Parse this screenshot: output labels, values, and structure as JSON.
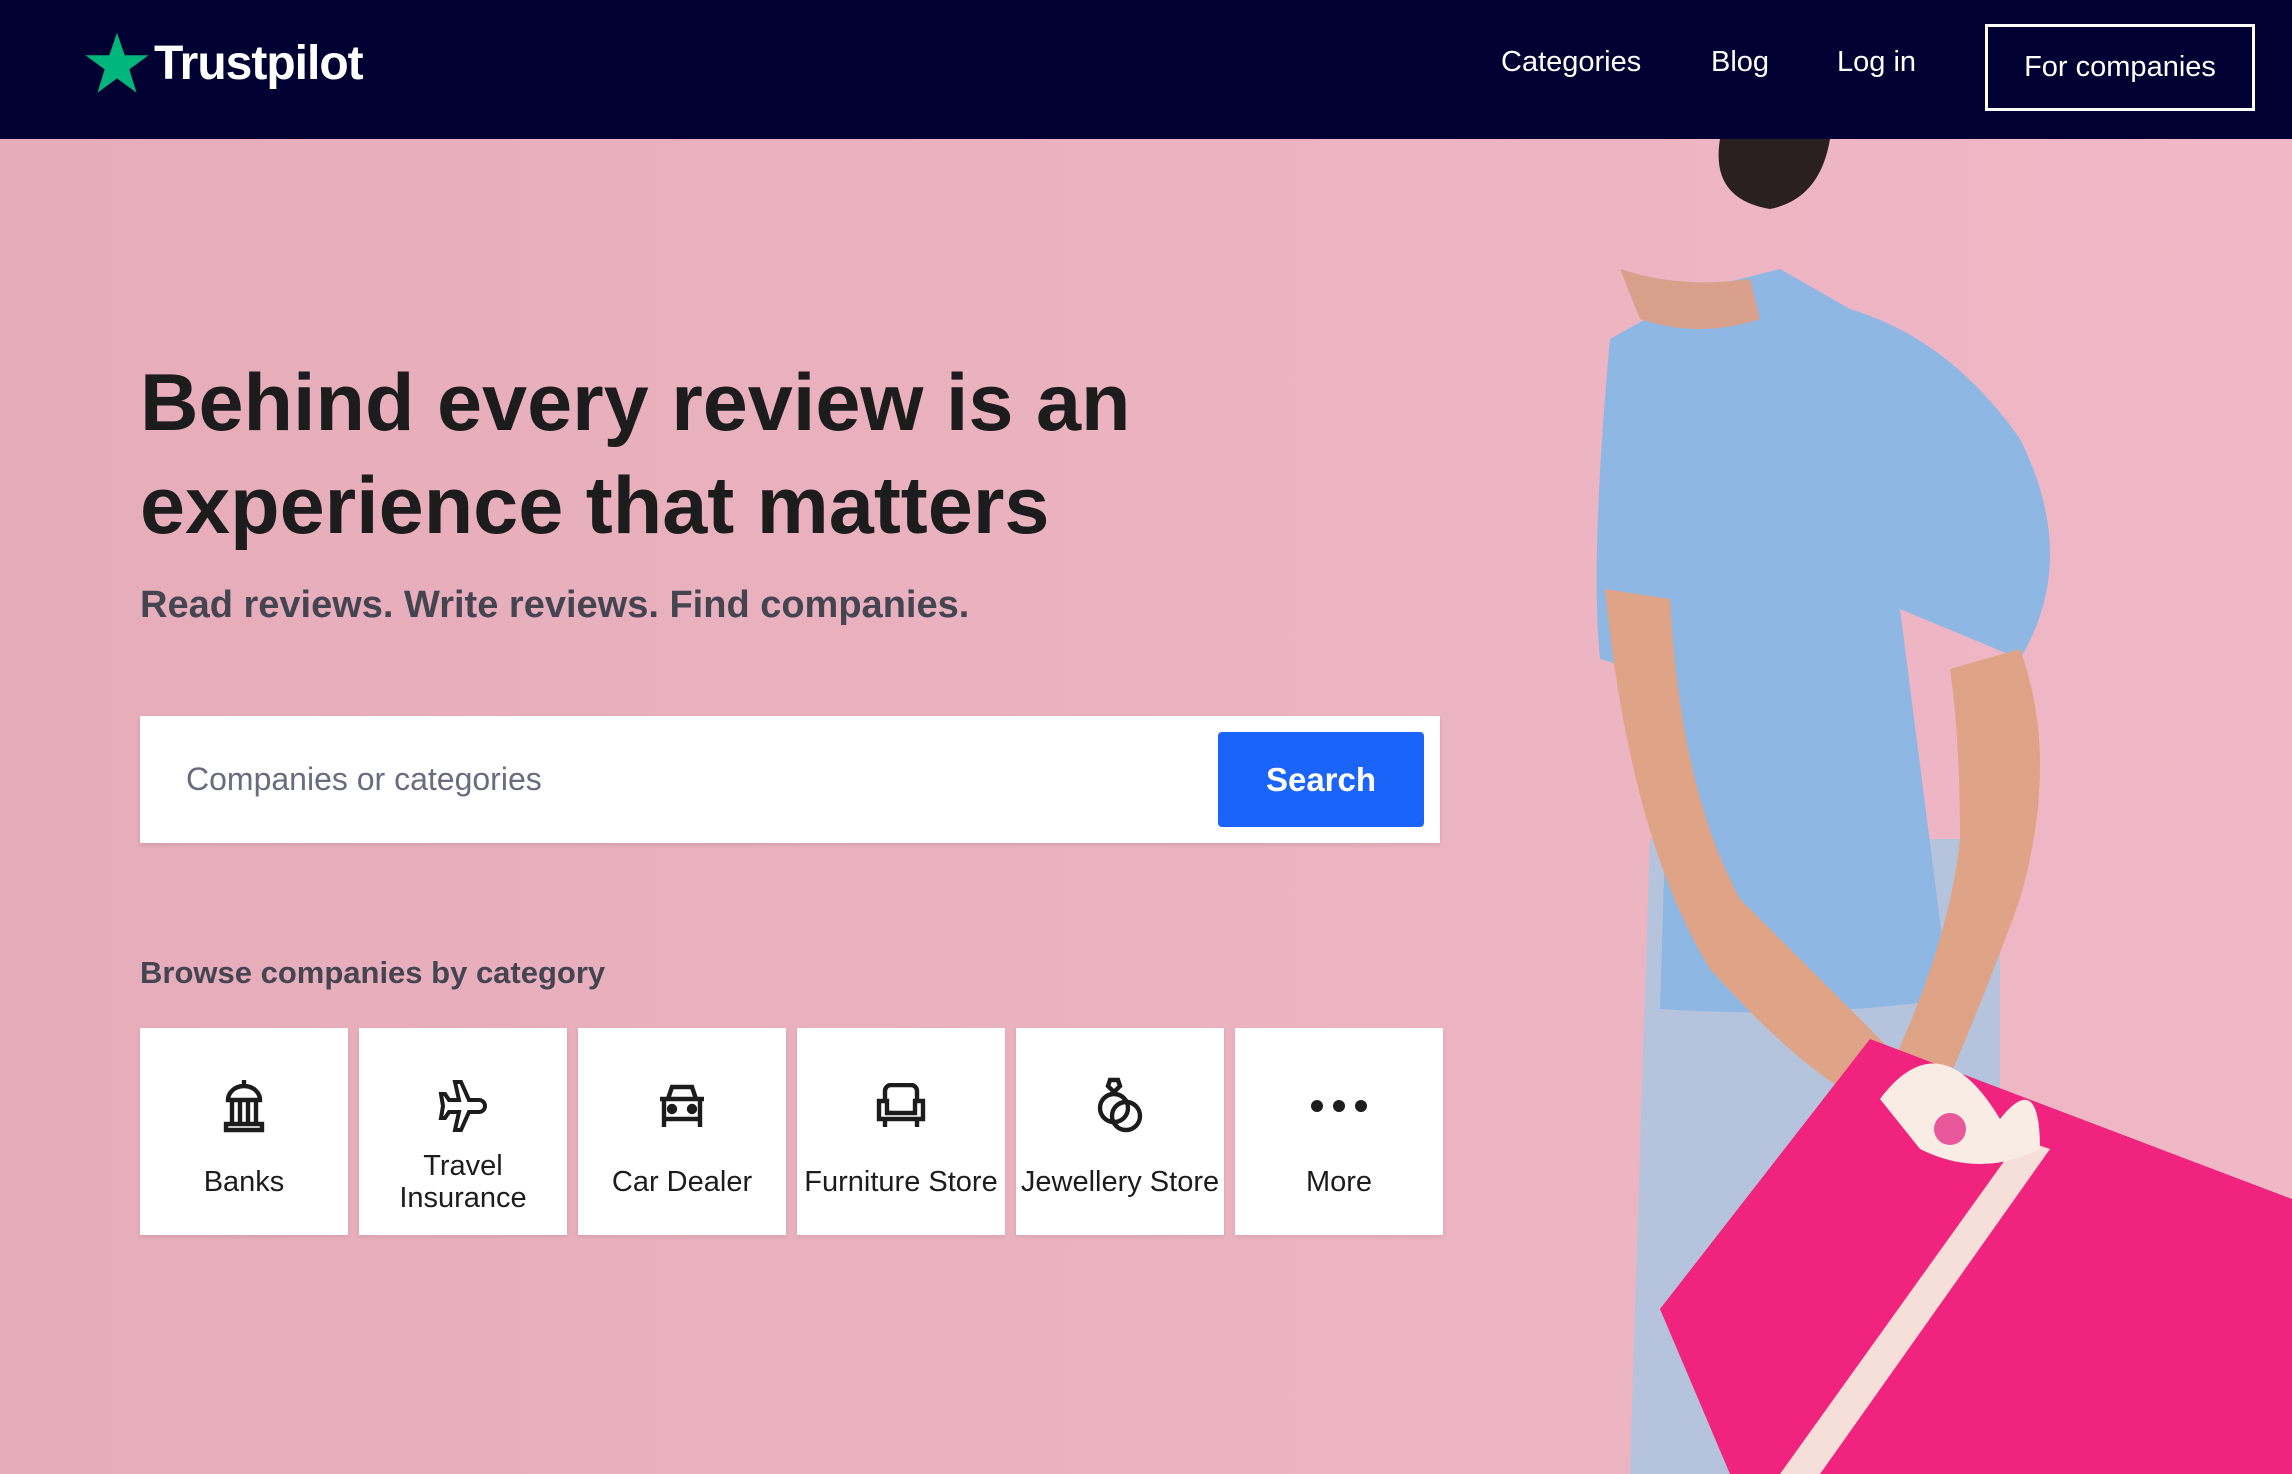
{
  "nav": {
    "logo": "Trustpilot",
    "links": [
      "Categories",
      "Blog",
      "Log in"
    ],
    "for_companies": "For companies"
  },
  "hero": {
    "title": "Behind every review is an experience that matters",
    "subtitle": "Read reviews. Write reviews. Find companies."
  },
  "search": {
    "placeholder": "Companies or categories",
    "button": "Search"
  },
  "browse": {
    "heading": "Browse companies by category",
    "categories": [
      {
        "label": "Banks",
        "icon": "bank-icon"
      },
      {
        "label": "Travel Insurance",
        "icon": "airplane-icon"
      },
      {
        "label": "Car Dealer",
        "icon": "car-icon"
      },
      {
        "label": "Furniture Store",
        "icon": "armchair-icon"
      },
      {
        "label": "Jewellery Store",
        "icon": "rings-icon"
      },
      {
        "label": "More",
        "icon": "more-dots-icon"
      }
    ]
  },
  "colors": {
    "nav": "#000032",
    "accent": "#1a64fa",
    "star": "#00b67a",
    "hero": "#e8adb9"
  }
}
